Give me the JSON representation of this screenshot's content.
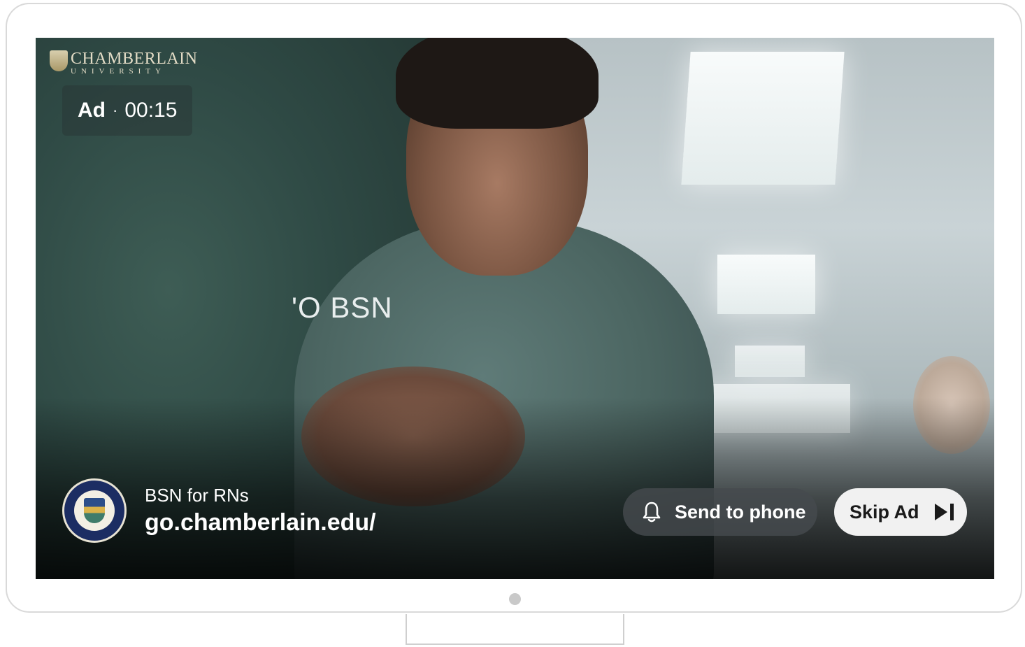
{
  "brand": {
    "name": "CHAMBERLAIN",
    "subtitle": "UNIVERSITY"
  },
  "ad": {
    "label": "Ad",
    "separator": "·",
    "countdown": "00:15"
  },
  "video": {
    "overlay_text": "'O BSN"
  },
  "sponsor": {
    "title": "BSN for RNs",
    "url": "go.chamberlain.edu/"
  },
  "actions": {
    "send_to_phone": "Send to phone",
    "skip_ad": "Skip Ad"
  },
  "icons": {
    "bell": "bell-icon",
    "skip": "skip-next-icon"
  },
  "colors": {
    "skip_button_bg": "#f1f1f1",
    "send_button_bg": "#464b4e"
  }
}
